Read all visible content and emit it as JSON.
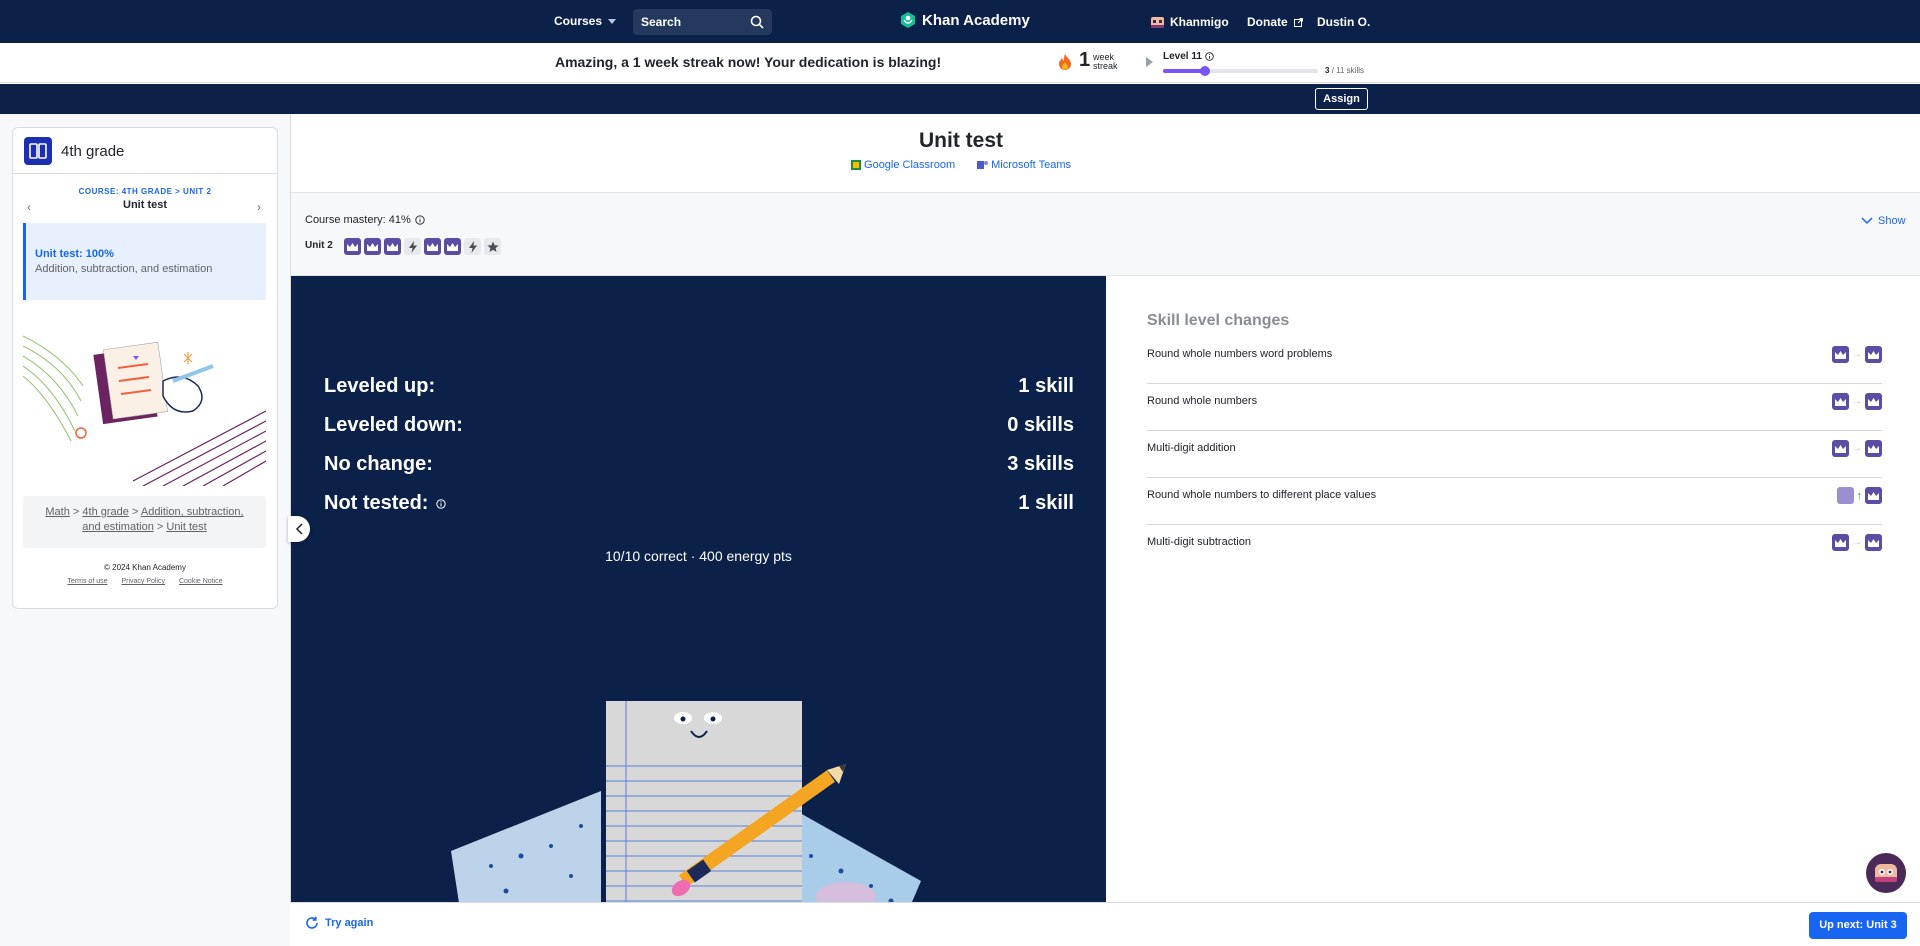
{
  "nav": {
    "courses": "Courses",
    "search_placeholder": "Search",
    "logo": "Khan Academy",
    "khanmigo": "Khanmigo",
    "donate": "Donate",
    "user": "Dustin O."
  },
  "streak": {
    "message": "Amazing, a 1 week streak now! Your dedication is blazing!",
    "count": "1",
    "unit_line1": "week",
    "unit_line2": "streak",
    "level": "Level 11",
    "skills_done": "3",
    "skills_total": "/ 11 skills",
    "progress_fraction": 0.27
  },
  "assign": "Assign",
  "sidebar": {
    "course": "4th grade",
    "crumb": "COURSE: 4TH GRADE > UNIT 2",
    "unit_title": "Unit test",
    "active_title": "Unit test: 100%",
    "active_subtitle": "Addition, subtraction, and estimation",
    "breadcrumb": {
      "math": "Math",
      "grade": "4th grade",
      "topic_a": "Addition, subtraction,",
      "topic_b": "and estimation",
      "test": "Unit test",
      "sep": ">"
    },
    "copyright": "© 2024 Khan Academy",
    "terms": "Terms of use",
    "privacy": "Privacy Policy",
    "cookie": "Cookie Notice"
  },
  "main": {
    "title": "Unit test",
    "google": "Google Classroom",
    "teams": "Microsoft Teams",
    "mastery": "Course mastery: 41%",
    "show": "Show",
    "unit_label": "Unit 2"
  },
  "results": {
    "rows": [
      {
        "label": "Leveled up:",
        "value": "1 skill"
      },
      {
        "label": "Leveled down:",
        "value": "0 skills"
      },
      {
        "label": "No change:",
        "value": "3 skills"
      },
      {
        "label": "Not tested:",
        "value": "1 skill"
      }
    ],
    "summary": "10/10 correct · 400 energy pts"
  },
  "skills": {
    "header": "Skill level changes",
    "items": [
      {
        "name": "Round whole numbers word problems",
        "change": "same"
      },
      {
        "name": "Round whole numbers",
        "change": "same"
      },
      {
        "name": "Multi-digit addition",
        "change": "same"
      },
      {
        "name": "Round whole numbers to different place values",
        "change": "up"
      },
      {
        "name": "Multi-digit subtraction",
        "change": "same"
      }
    ]
  },
  "bottom": {
    "try_again": "Try again",
    "next": "Up next: Unit 3"
  },
  "colors": {
    "navy": "#0b2149",
    "blue": "#1865f2",
    "mastered": "#5c4ca3",
    "progress": "#7854f7"
  }
}
